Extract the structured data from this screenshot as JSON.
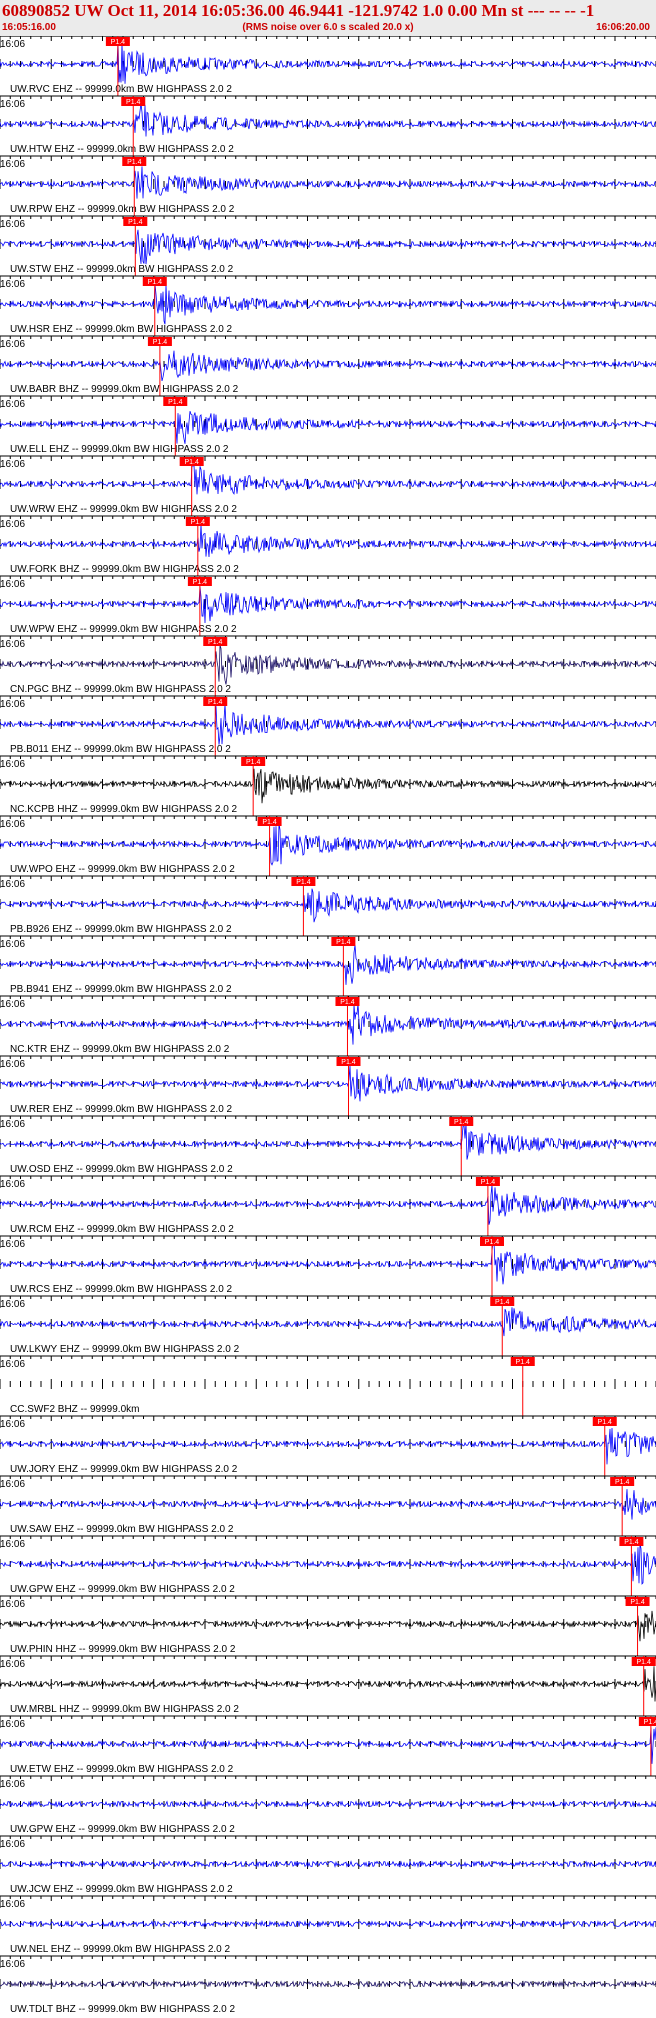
{
  "header": {
    "title": "60890852 UW Oct 11, 2014 16:05:36.00   46.9441 -121.9742  1.0 0.00 Mn st --- -- --   -1",
    "subtitle": "(RMS noise over 6.0 s scaled 20.0 x)",
    "start_time": "16:05:16.00",
    "end_time": "16:06:20.00"
  },
  "colors": {
    "trace": "#0000ff",
    "trace_alt": "#000000",
    "trace_dark": "#1a0f66",
    "pick": "#ff0000",
    "header_text": "#cc0000"
  },
  "chart_data": {
    "type": "line",
    "title": "60890852 UW Oct 11, 2014 16:05:36.00   46.9441 -121.9742  1.0 0.00 Mn st --- -- --   -1",
    "xlabel": "",
    "ylabel": "",
    "xlim": [
      "16:05:16.00",
      "16:06:20.00"
    ],
    "minute_mark": "16:06",
    "pick_label": "P1.4",
    "series": [
      {
        "label": "UW.RVC EHZ -- 99999.0km BW  HIGHPASS  2.0  2",
        "pick_time": "16:05:27.5",
        "color": "blue"
      },
      {
        "label": "UW.HTW EHZ -- 99999.0km BW  HIGHPASS  2.0  2",
        "pick_time": "16:05:29.0",
        "color": "blue"
      },
      {
        "label": "UW.RPW EHZ -- 99999.0km BW  HIGHPASS  2.0  2",
        "pick_time": "16:05:29.1",
        "color": "blue"
      },
      {
        "label": "UW.STW EHZ -- 99999.0km BW  HIGHPASS  2.0  2",
        "pick_time": "16:05:29.2",
        "color": "blue"
      },
      {
        "label": "UW.HSR EHZ -- 99999.0km BW  HIGHPASS  2.0  2",
        "pick_time": "16:05:31.1",
        "color": "blue"
      },
      {
        "label": "UW.BABR BHZ -- 99999.0km BW  HIGHPASS  2.0  2",
        "pick_time": "16:05:31.6",
        "color": "blue"
      },
      {
        "label": "UW.ELL EHZ -- 99999.0km BW  HIGHPASS  2.0  2",
        "pick_time": "16:05:33.1",
        "color": "blue"
      },
      {
        "label": "UW.WRW EHZ -- 99999.0km BW  HIGHPASS  2.0  2",
        "pick_time": "16:05:34.7",
        "color": "blue"
      },
      {
        "label": "UW.FORK BHZ -- 99999.0km BW  HIGHPASS  2.0  2",
        "pick_time": "16:05:35.3",
        "color": "blue"
      },
      {
        "label": "UW.WPW EHZ -- 99999.0km BW  HIGHPASS  2.0  2",
        "pick_time": "16:05:35.5",
        "color": "blue"
      },
      {
        "label": "CN.PGC BHZ -- 99999.0km BW  HIGHPASS  2.0  2",
        "pick_time": "16:05:37.0",
        "color": "dark"
      },
      {
        "label": "PB.B011 EHZ -- 99999.0km BW  HIGHPASS  2.0  2",
        "pick_time": "16:05:37.0",
        "color": "blue"
      },
      {
        "label": "NC.KCPB HHZ -- 99999.0km BW  HIGHPASS  2.0  2",
        "pick_time": "16:05:40.7",
        "color": "black"
      },
      {
        "label": "UW.WPO EHZ -- 99999.0km BW  HIGHPASS  2.0  2",
        "pick_time": "16:05:42.3",
        "color": "blue"
      },
      {
        "label": "PB.B926 EHZ -- 99999.0km BW  HIGHPASS  2.0  2",
        "pick_time": "16:05:45.6",
        "color": "blue"
      },
      {
        "label": "PB.B941 EHZ -- 99999.0km BW  HIGHPASS  2.0  2",
        "pick_time": "16:05:49.5",
        "color": "blue"
      },
      {
        "label": "NC.KTR EHZ -- 99999.0km BW  HIGHPASS  2.0  2",
        "pick_time": "16:05:49.9",
        "color": "blue"
      },
      {
        "label": "UW.RER EHZ -- 99999.0km BW  HIGHPASS  2.0  2",
        "pick_time": "16:05:50.0",
        "color": "blue"
      },
      {
        "label": "UW.OSD EHZ -- 99999.0km BW  HIGHPASS  2.0  2",
        "pick_time": "16:06:01.0",
        "color": "blue"
      },
      {
        "label": "UW.RCM EHZ -- 99999.0km BW  HIGHPASS  2.0  2",
        "pick_time": "16:06:03.6",
        "color": "blue"
      },
      {
        "label": "UW.RCS EHZ -- 99999.0km BW  HIGHPASS  2.0  2",
        "pick_time": "16:06:04.0",
        "color": "blue"
      },
      {
        "label": "UW.LKWY EHZ -- 99999.0km BW  HIGHPASS  2.0  2",
        "pick_time": "16:06:05.0",
        "color": "blue"
      },
      {
        "label": "CC.SWF2 BHZ -- 99999.0km",
        "pick_time": "16:06:07.0",
        "color": "none"
      },
      {
        "label": "UW.JORY EHZ -- 99999.0km BW  HIGHPASS  2.0  2",
        "pick_time": "16:06:15.0",
        "color": "blue"
      },
      {
        "label": "UW.SAW EHZ -- 99999.0km BW  HIGHPASS  2.0  2",
        "pick_time": "16:06:16.7",
        "color": "blue"
      },
      {
        "label": "UW.GPW EHZ -- 99999.0km BW  HIGHPASS  2.0  2",
        "pick_time": "16:06:17.6",
        "color": "blue"
      },
      {
        "label": "UW.PHIN HHZ -- 99999.0km BW  HIGHPASS  2.0  2",
        "pick_time": "16:06:18.2",
        "color": "black"
      },
      {
        "label": "UW.MRBL HHZ -- 99999.0km BW  HIGHPASS  2.0  2",
        "pick_time": "16:06:18.8",
        "color": "black"
      },
      {
        "label": "UW.ETW EHZ -- 99999.0km BW  HIGHPASS  2.0  2",
        "pick_time": "16:06:19.5",
        "color": "blue"
      },
      {
        "label": "UW.GPW EHZ -- 99999.0km BW  HIGHPASS  2.0  2",
        "pick_time": null,
        "color": "blue"
      },
      {
        "label": "UW.JCW EHZ -- 99999.0km BW  HIGHPASS  2.0  2",
        "pick_time": null,
        "color": "blue"
      },
      {
        "label": "UW.NEL EHZ -- 99999.0km BW  HIGHPASS  2.0  2",
        "pick_time": null,
        "color": "blue"
      },
      {
        "label": "UW.TDLT BHZ -- 99999.0km BW  HIGHPASS  2.0  2",
        "pick_time": null,
        "color": "dark"
      }
    ]
  }
}
